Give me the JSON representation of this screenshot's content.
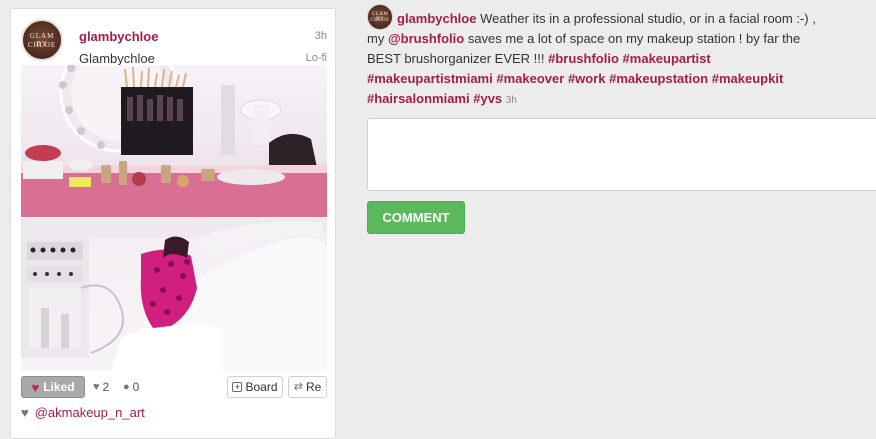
{
  "post": {
    "username": "glambychloe",
    "full_name": "Glambychloe",
    "time": "3h",
    "filter": "Lo-fi",
    "avatar_text_1": "GLAM BY",
    "avatar_text_2": "CHLOE",
    "photo_icon": "makeup-station-photo"
  },
  "actions": {
    "liked_label": "Liked",
    "likes_count": "2",
    "comments_count": "0",
    "board_label": "Board",
    "repost_label": "Re",
    "liker": "@akmakeup_n_art"
  },
  "caption": {
    "username": "glambychloe",
    "text_1": "Weather its in a professional studio, or in a facial room :-) , my",
    "mention": "@brushfolio",
    "text_2": "saves me a lot of space on my makeup station ! by far the BEST brushorganizer EVER !!!",
    "tag_1": "#brushfolio",
    "tag_2": "#makeupartist",
    "tag_3": "#makeupartistmiami",
    "tag_4": "#makeover",
    "tag_5": "#work",
    "tag_6": "#makeupstation",
    "tag_7": "#makeupkit",
    "tag_8": "#hairsalonmiami",
    "tag_9": "#yvs",
    "time": "3h"
  },
  "comment": {
    "placeholder": "",
    "button_label": "COMMENT"
  },
  "colors": {
    "accent": "#a0204a",
    "comment_button": "#5cb85c",
    "liked_button": "#a9a9a9",
    "heart": "#d0243f"
  }
}
